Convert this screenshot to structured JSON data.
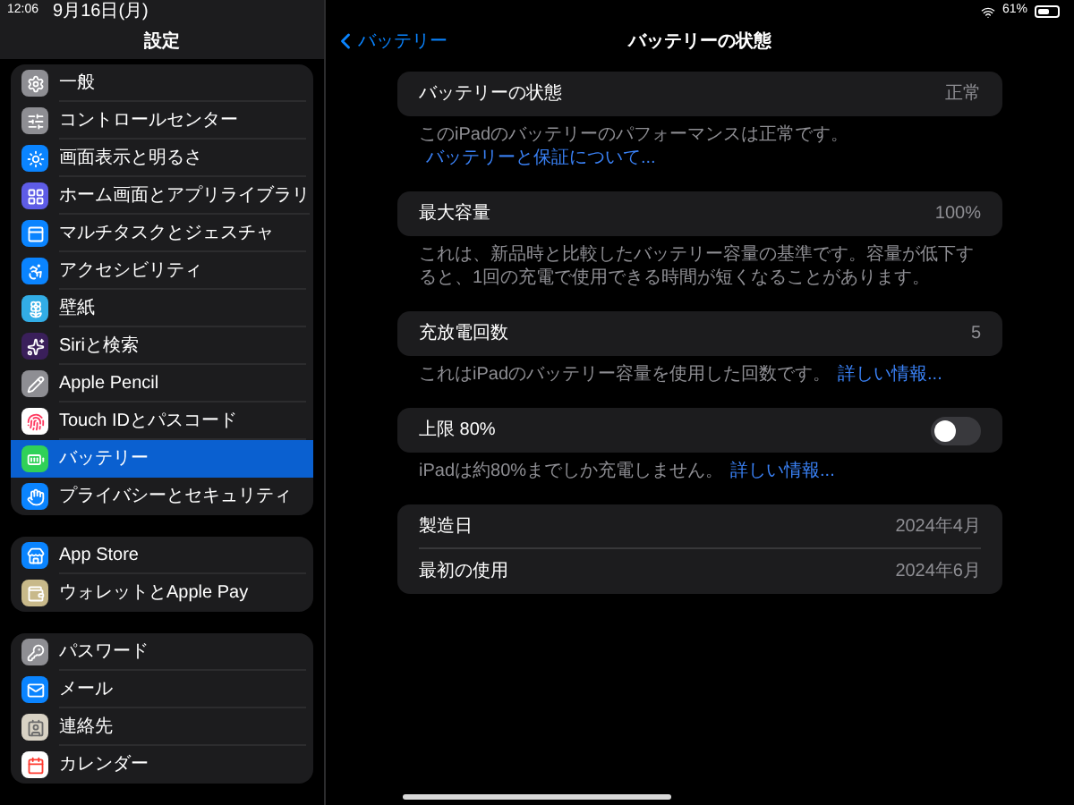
{
  "status_bar": {
    "time": "12:06",
    "date": "9月16日(月)",
    "battery": "61%"
  },
  "sidebar": {
    "title": "設定",
    "groups": [
      [
        {
          "label": "一般",
          "selected": false
        },
        {
          "label": "コントロールセンター",
          "selected": false
        },
        {
          "label": "画面表示と明るさ",
          "selected": false
        },
        {
          "label": "ホーム画面とアプリライブラリ",
          "selected": false
        },
        {
          "label": "マルチタスクとジェスチャ",
          "selected": false
        },
        {
          "label": "アクセシビリティ",
          "selected": false
        },
        {
          "label": "壁紙",
          "selected": false
        },
        {
          "label": "Siriと検索",
          "selected": false
        },
        {
          "label": "Apple Pencil",
          "selected": false
        },
        {
          "label": "Touch IDとパスコード",
          "selected": false
        },
        {
          "label": "バッテリー",
          "selected": true
        },
        {
          "label": "プライバシーとセキュリティ",
          "selected": false
        }
      ],
      [
        {
          "label": "App Store",
          "selected": false
        },
        {
          "label": "ウォレットとApple Pay",
          "selected": false
        }
      ],
      [
        {
          "label": "パスワード",
          "selected": false
        },
        {
          "label": "メール",
          "selected": false
        },
        {
          "label": "連絡先",
          "selected": false
        },
        {
          "label": "カレンダー",
          "selected": false
        }
      ]
    ]
  },
  "detail": {
    "back": "バッテリー",
    "title": "バッテリーの状態",
    "sections": [
      {
        "kind": "value",
        "rows": [
          {
            "label": "バッテリーの状態",
            "value": "正常"
          }
        ],
        "footnote": {
          "text": "このiPadのバッテリーのパフォーマンスは正常です。",
          "link": "バッテリーと保証について..."
        }
      },
      {
        "kind": "value",
        "rows": [
          {
            "label": "最大容量",
            "value": "100%"
          }
        ],
        "footnote": {
          "text": "これは、新品時と比較したバッテリー容量の基準です。容量が低下すると、1回の充電で使用できる時間が短くなることがあります。"
        }
      },
      {
        "kind": "value",
        "rows": [
          {
            "label": "充放電回数",
            "value": "5"
          }
        ],
        "footnote": {
          "text": "これはiPadのバッテリー容量を使用した回数です。",
          "link": "詳しい情報..."
        }
      },
      {
        "kind": "toggle",
        "rows": [
          {
            "label": "上限 80%",
            "on": false
          }
        ],
        "footnote": {
          "text": "iPadは約80%までしか充電しません。",
          "link": "詳しい情報..."
        }
      },
      {
        "kind": "value",
        "rows": [
          {
            "label": "製造日",
            "value": "2024年4月"
          },
          {
            "label": "最初の使用",
            "value": "2024年6月"
          }
        ]
      }
    ]
  }
}
